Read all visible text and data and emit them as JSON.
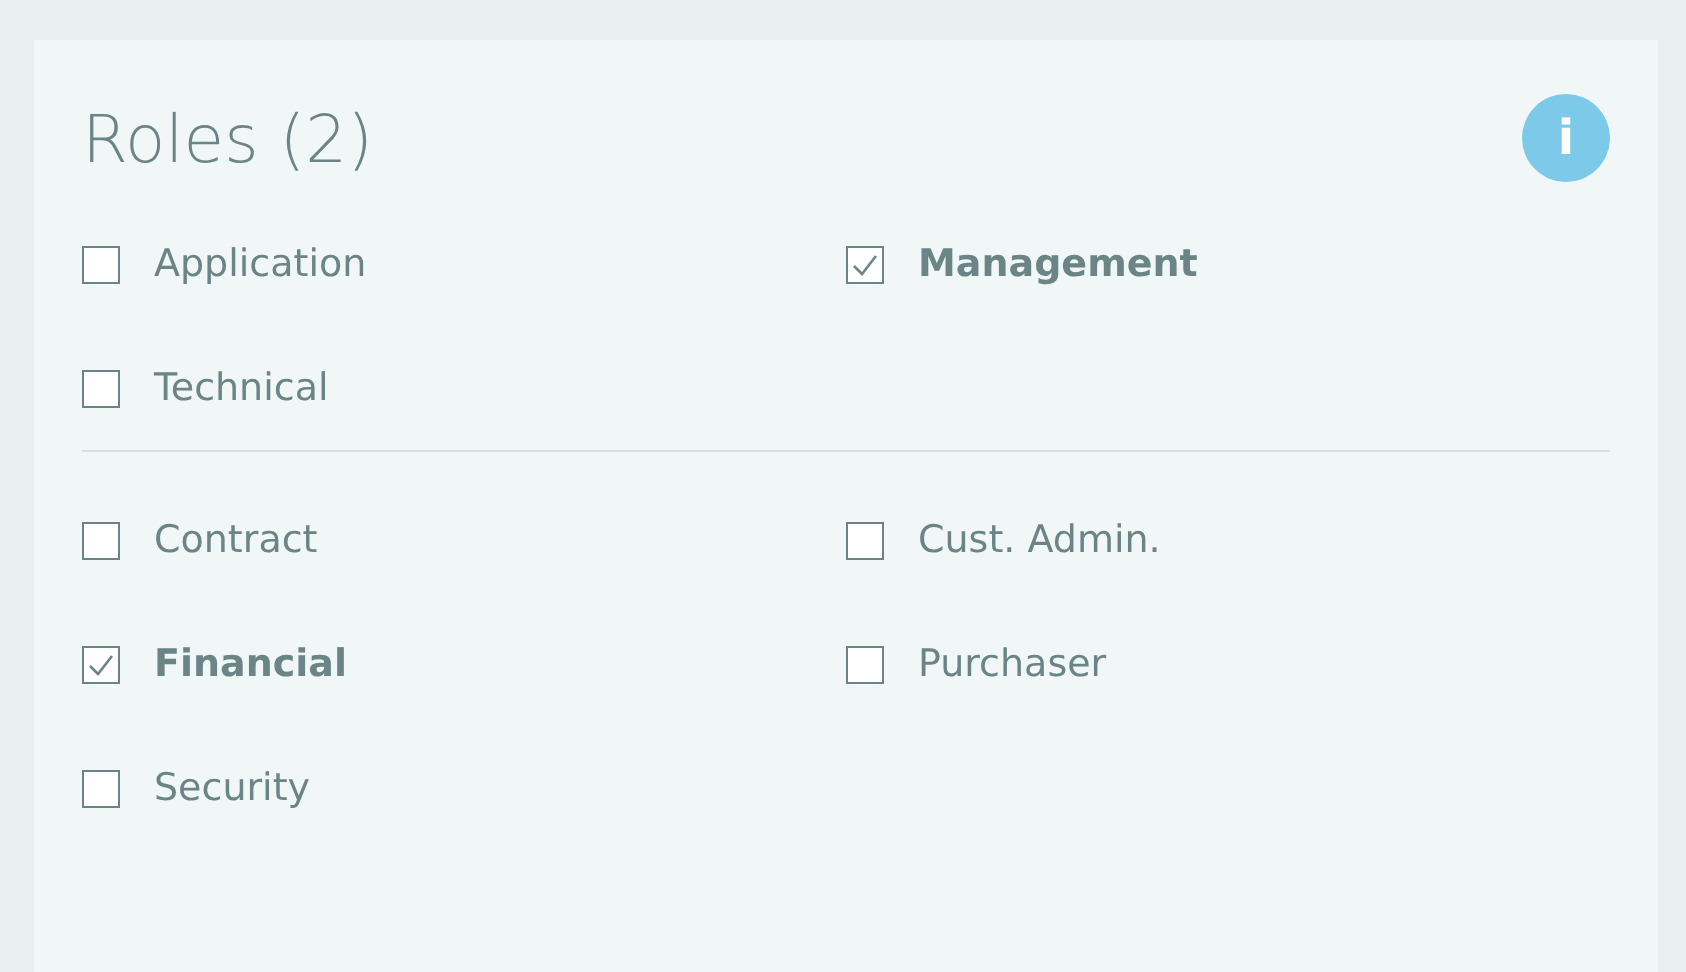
{
  "title": "Roles (2)",
  "info_button": {
    "label": "i"
  },
  "groups": [
    {
      "roles": [
        {
          "label": "Application",
          "checked": false
        },
        {
          "label": "Management",
          "checked": true
        },
        {
          "label": "Technical",
          "checked": false
        }
      ]
    },
    {
      "roles": [
        {
          "label": "Contract",
          "checked": false
        },
        {
          "label": "Cust. Admin.",
          "checked": false
        },
        {
          "label": "Financial",
          "checked": true
        },
        {
          "label": "Purchaser",
          "checked": false
        },
        {
          "label": "Security",
          "checked": false
        }
      ]
    }
  ]
}
